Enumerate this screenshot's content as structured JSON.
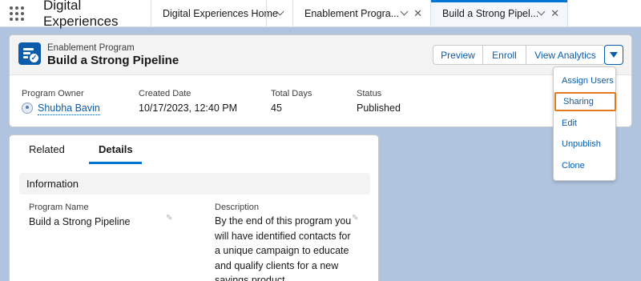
{
  "topbar": {
    "app_name": "Digital Experiences",
    "tabs": [
      {
        "label": "Digital Experiences Home"
      },
      {
        "label": "Enablement Progra..."
      },
      {
        "label": "Build a Strong Pipel..."
      }
    ]
  },
  "header": {
    "object_label": "Enablement Program",
    "record_title": "Build a Strong Pipeline",
    "actions": {
      "preview": "Preview",
      "enroll": "Enroll",
      "analytics": "View Analytics"
    },
    "fields": [
      {
        "label": "Program Owner",
        "value": "Shubha Bavin"
      },
      {
        "label": "Created Date",
        "value": "10/17/2023, 12:40 PM"
      },
      {
        "label": "Total Days",
        "value": "45"
      },
      {
        "label": "Status",
        "value": "Published"
      }
    ]
  },
  "menu": {
    "items": [
      {
        "label": "Assign Users"
      },
      {
        "label": "Sharing"
      },
      {
        "label": "Edit"
      },
      {
        "label": "Unpublish"
      },
      {
        "label": "Clone"
      }
    ],
    "highlighted": "Sharing"
  },
  "detail": {
    "tabs": [
      {
        "label": "Related"
      },
      {
        "label": "Details"
      }
    ],
    "active_tab": "Details",
    "section_title": "Information",
    "fields": [
      {
        "label": "Program Name",
        "value": "Build a Strong Pipeline"
      },
      {
        "label": "Description",
        "value": "By the end of this program you will have identified contacts for a unique campaign to educate and qualify clients for a new savings product."
      }
    ]
  },
  "colors": {
    "brand": "#0b5cab",
    "accent_tab": "#0176d3",
    "highlight": "#e07a1f",
    "background": "#b0c4df"
  }
}
